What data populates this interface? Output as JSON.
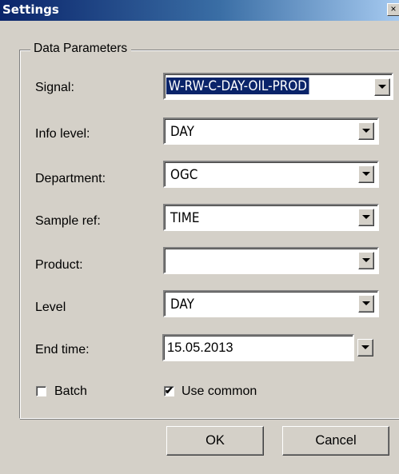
{
  "window": {
    "title": "Settings",
    "close_glyph": "×"
  },
  "group": {
    "legend": "Data Parameters"
  },
  "fields": {
    "signal": {
      "label": "Signal:",
      "value": "W-RW-C-DAY-OIL-PROD"
    },
    "info_level": {
      "label": "Info level:",
      "value": "DAY"
    },
    "department": {
      "label": "Department:",
      "value": "OGC"
    },
    "sample_ref": {
      "label": "Sample ref:",
      "value": "TIME"
    },
    "product": {
      "label": "Product:",
      "value": ""
    },
    "level": {
      "label": "Level",
      "value": "DAY"
    },
    "end_time": {
      "label": "End time:",
      "value": "15.05.2013"
    }
  },
  "checkboxes": {
    "batch": {
      "label": "Batch",
      "checked": false,
      "mark": ""
    },
    "use_common": {
      "label": "Use common",
      "checked": true,
      "mark": "✔"
    }
  },
  "buttons": {
    "ok": "OK",
    "cancel": "Cancel"
  },
  "icons": {
    "dropdown": "chevron-down-icon",
    "close": "close-icon",
    "check": "check-icon"
  },
  "colors": {
    "titlebar_start": "#0a246a",
    "titlebar_end": "#a6caf0",
    "face": "#d4d0c8",
    "selection": "#0a246a"
  }
}
